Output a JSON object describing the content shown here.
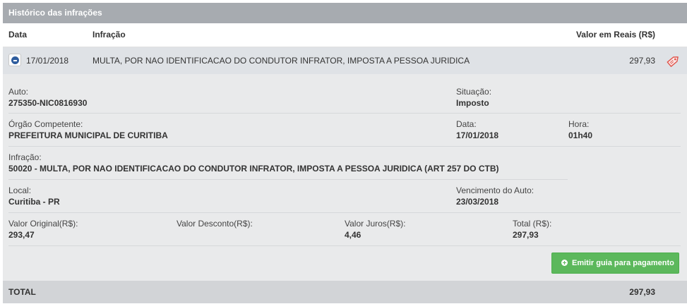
{
  "panel": {
    "title": "Histórico das infrações"
  },
  "columns": {
    "date": "Data",
    "infraction": "Infração",
    "value": "Valor em Reais (R$)"
  },
  "row": {
    "date": "17/01/2018",
    "description": "MULTA, POR NAO IDENTIFICACAO DO CONDUTOR INFRATOR, IMPOSTA A PESSOA JURIDICA",
    "value": "297,93",
    "toggle_icon": "minus-circle-icon",
    "tag_icon": "price-tag-icon"
  },
  "details": {
    "auto": {
      "label": "Auto:",
      "value": "275350-NIC0816930"
    },
    "situacao": {
      "label": "Situação:",
      "value": "Imposto"
    },
    "orgao": {
      "label": "Órgão Competente:",
      "value": "PREFEITURA MUNICIPAL DE CURITIBA"
    },
    "data": {
      "label": "Data:",
      "value": "17/01/2018"
    },
    "hora": {
      "label": "Hora:",
      "value": "01h40"
    },
    "infracao": {
      "label": "Infração:",
      "value": "50020 - MULTA, POR NAO IDENTIFICACAO DO CONDUTOR INFRATOR, IMPOSTA A PESSOA JURIDICA (ART 257 DO CTB)"
    },
    "local": {
      "label": "Local:",
      "value": "Curitiba - PR"
    },
    "vencimento": {
      "label": "Vencimento do Auto:",
      "value": "23/03/2018"
    },
    "valor_original": {
      "label": "Valor Original(R$):",
      "value": "293,47"
    },
    "valor_desconto": {
      "label": "Valor Desconto(R$):",
      "value": ""
    },
    "valor_juros": {
      "label": "Valor Juros(R$):",
      "value": "4,46"
    },
    "total": {
      "label": "Total (R$):",
      "value": "297,93"
    }
  },
  "actions": {
    "emit_label": "Emitir guia para pagamento",
    "emit_icon": "plus-circle-icon"
  },
  "footer": {
    "total_label": "TOTAL",
    "total_value": "297,93"
  },
  "colors": {
    "header_bg": "#a7abb0",
    "row_bg": "#dfe2e6",
    "detail_bg": "#e9eaeb",
    "button_green": "#5cb85c",
    "tag_red": "#e0534a"
  }
}
